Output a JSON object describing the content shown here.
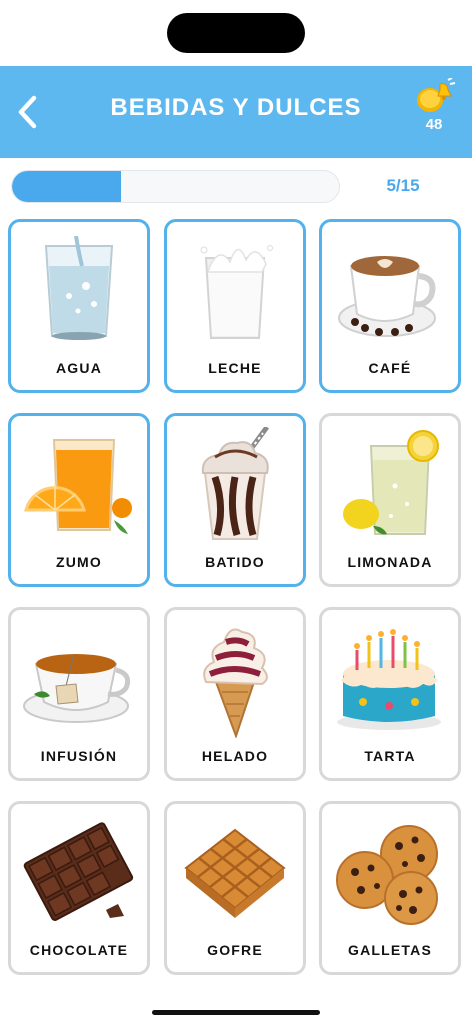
{
  "header": {
    "title": "BEBIDAS Y DULCES",
    "coins": "48",
    "back_icon": "chevron-left-icon",
    "coin_icon": "gold-coin-bell-icon",
    "color": "#5db8f0"
  },
  "progress": {
    "current": 5,
    "total": 15,
    "fraction": 0.333,
    "label": "5/15",
    "color": "#4aa9ec"
  },
  "cards": [
    {
      "label": "AGUA",
      "selected": true
    },
    {
      "label": "LECHE",
      "selected": true
    },
    {
      "label": "CAFÉ",
      "selected": true
    },
    {
      "label": "ZUMO",
      "selected": true
    },
    {
      "label": "BATIDO",
      "selected": true
    },
    {
      "label": "LIMONADA",
      "selected": false
    },
    {
      "label": "INFUSIÓN",
      "selected": false
    },
    {
      "label": "HELADO",
      "selected": false
    },
    {
      "label": "TARTA",
      "selected": false
    },
    {
      "label": "CHOCOLATE",
      "selected": false
    },
    {
      "label": "GOFRE",
      "selected": false
    },
    {
      "label": "GALLETAS",
      "selected": false
    }
  ]
}
